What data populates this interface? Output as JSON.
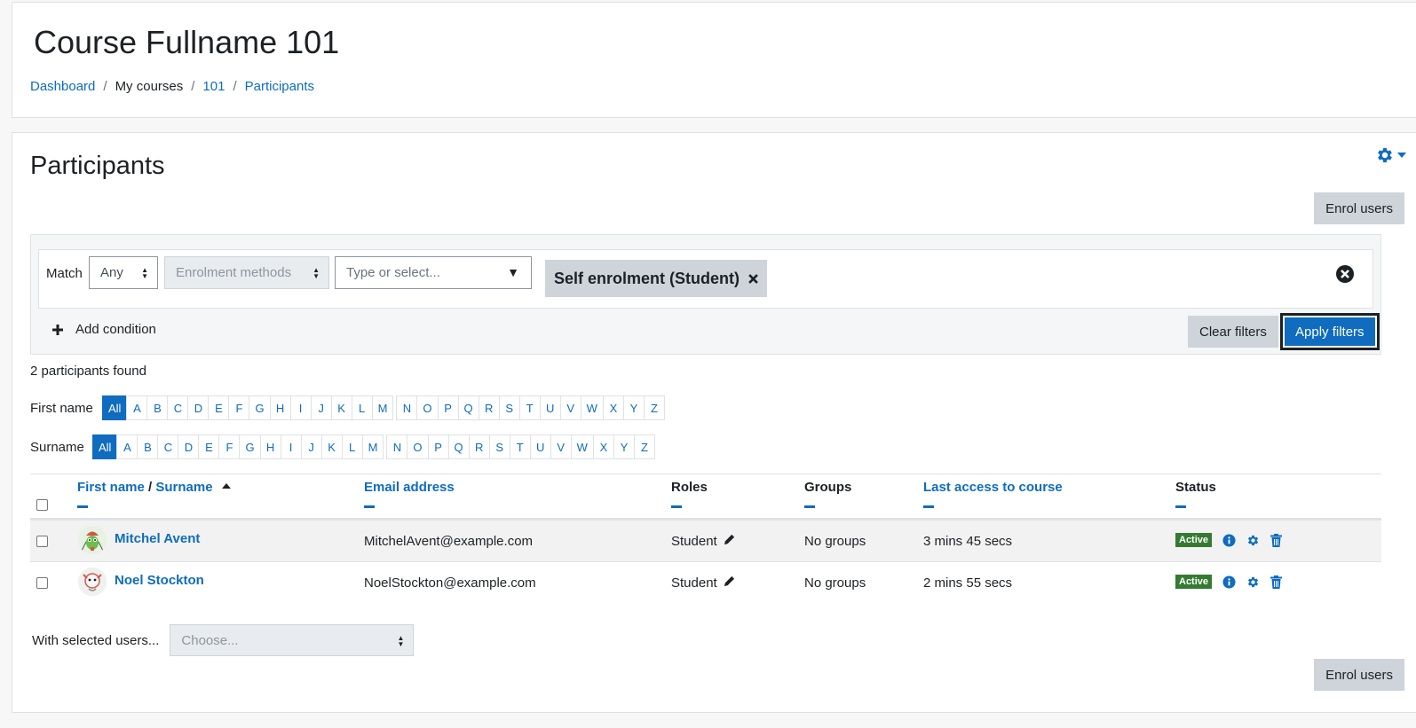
{
  "header": {
    "title": "Course Fullname 101",
    "breadcrumb": [
      {
        "label": "Dashboard",
        "link": true
      },
      {
        "label": "My courses",
        "link": false
      },
      {
        "label": "101",
        "link": true
      },
      {
        "label": "Participants",
        "link": true
      }
    ]
  },
  "main": {
    "heading": "Participants",
    "enrol_users_label": "Enrol users",
    "settings_icon": "gear-icon"
  },
  "filters": {
    "match_label": "Match",
    "match_value": "Any",
    "enrolment_methods": "Enrolment methods",
    "type_placeholder": "Type or select...",
    "selected_tag": "Self enrolment (Student)",
    "add_condition": "Add condition",
    "clear_filters": "Clear filters",
    "apply_filters": "Apply filters"
  },
  "participants_found": "2 participants found",
  "initials": {
    "first_name_label": "First name",
    "surname_label": "Surname",
    "all_label": "All",
    "letters_a_m": [
      "A",
      "B",
      "C",
      "D",
      "E",
      "F",
      "G",
      "H",
      "I",
      "J",
      "K",
      "L",
      "M"
    ],
    "letters_n_z": [
      "N",
      "O",
      "P",
      "Q",
      "R",
      "S",
      "T",
      "U",
      "V",
      "W",
      "X",
      "Y",
      "Z"
    ]
  },
  "table": {
    "headers": {
      "first_name": "First name",
      "separator": " / ",
      "surname": "Surname",
      "email": "Email address",
      "roles": "Roles",
      "groups": "Groups",
      "last_access": "Last access to course",
      "status": "Status"
    },
    "rows": [
      {
        "name": "Mitchel Avent",
        "email": "MitchelAvent@example.com",
        "role": "Student",
        "groups": "No groups",
        "last_access": "3 mins 45 secs",
        "status": "Active"
      },
      {
        "name": "Noel Stockton",
        "email": "NoelStockton@example.com",
        "role": "Student",
        "groups": "No groups",
        "last_access": "2 mins 55 secs",
        "status": "Active"
      }
    ]
  },
  "bulk": {
    "label": "With selected users...",
    "placeholder": "Choose..."
  },
  "colors": {
    "link": "#0f6cbf",
    "active_badge": "#357a32",
    "secondary_button": "#ced4da"
  }
}
